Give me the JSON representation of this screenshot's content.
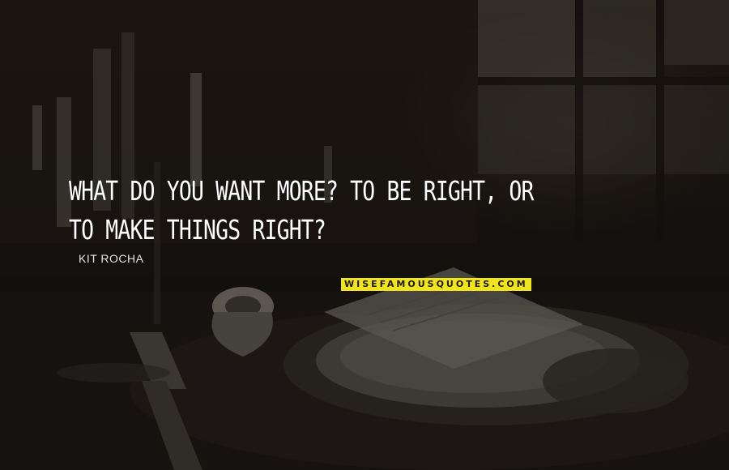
{
  "quote": {
    "text": "WHAT DO YOU WANT MORE? TO BE RIGHT, OR TO MAKE THINGS RIGHT?",
    "author": "KIT ROCHA"
  },
  "watermark": {
    "text": "WISEFAMOUSQUOTES.COM",
    "background": "#f2e41a"
  },
  "colors": {
    "quote_text": "#ffffff",
    "background": "#1f1a16"
  }
}
